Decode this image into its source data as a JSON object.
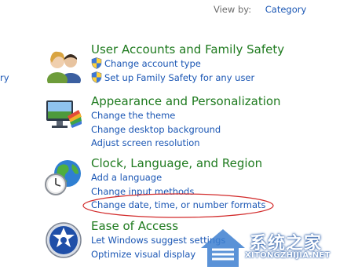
{
  "header": {
    "view_by_label": "View by:",
    "view_by_value": "Category"
  },
  "left_fragment": "ry",
  "categories": [
    {
      "title": "User Accounts and Family Safety",
      "icon": "users-icon",
      "links": [
        {
          "label": "Change account type",
          "shield": true
        },
        {
          "label": "Set up Family Safety for any user",
          "shield": true
        }
      ]
    },
    {
      "title": "Appearance and Personalization",
      "icon": "monitor-palette-icon",
      "links": [
        {
          "label": "Change the theme"
        },
        {
          "label": "Change desktop background"
        },
        {
          "label": "Adjust screen resolution"
        }
      ]
    },
    {
      "title": "Clock, Language, and Region",
      "icon": "globe-clock-icon",
      "links": [
        {
          "label": "Add a language"
        },
        {
          "label": "Change input methods"
        },
        {
          "label": "Change date, time, or number formats"
        }
      ]
    },
    {
      "title": "Ease of Access",
      "icon": "ease-of-access-icon",
      "links": [
        {
          "label": "Let Windows suggest settings"
        },
        {
          "label": "Optimize visual display"
        }
      ]
    }
  ],
  "highlight_color": "#d22a2a",
  "watermark": {
    "text_cn": "系统之家",
    "text_en": "XITONGZHIJIA.NET"
  }
}
